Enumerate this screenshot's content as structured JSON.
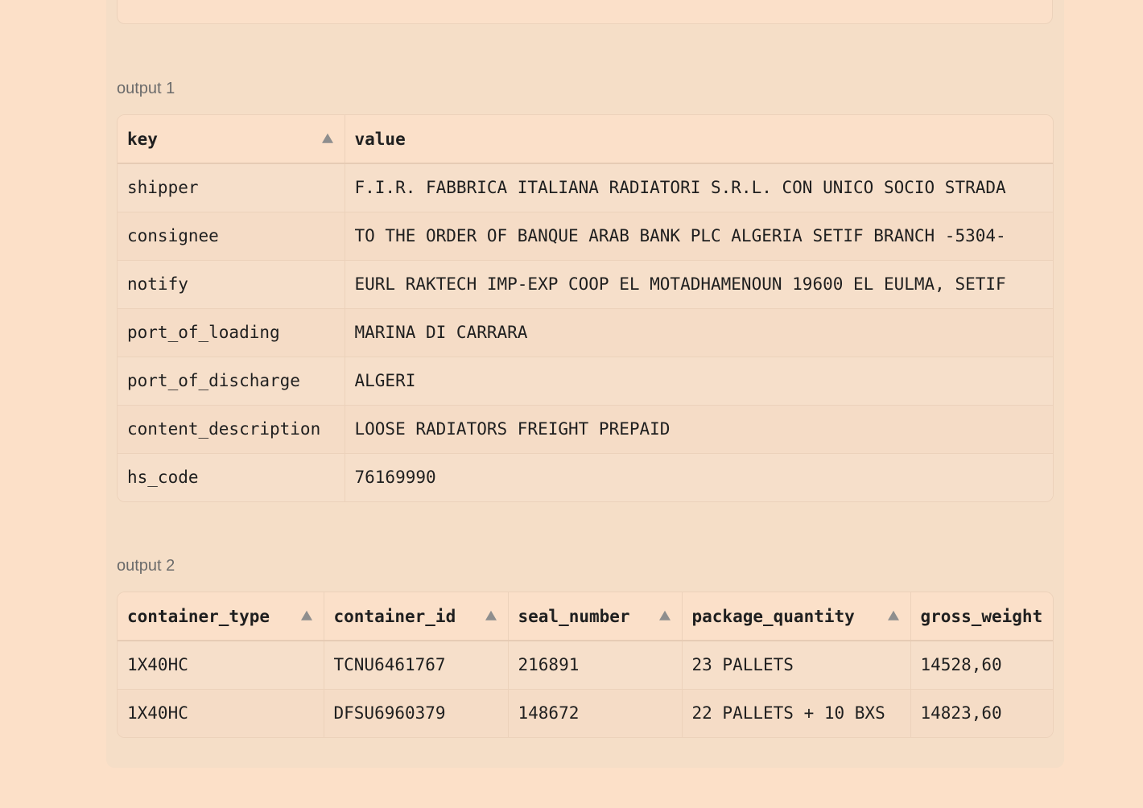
{
  "output1": {
    "label": "output 1",
    "columns": [
      "key",
      "value"
    ],
    "rows": [
      [
        "shipper",
        "F.I.R. FABBRICA ITALIANA RADIATORI S.R.L. CON UNICO SOCIO STRADA"
      ],
      [
        "consignee",
        "TO THE ORDER OF BANQUE ARAB BANK PLC ALGERIA SETIF BRANCH -5304-"
      ],
      [
        "notify",
        "EURL RAKTECH IMP-EXP COOP EL MOTADHAMENOUN 19600 EL EULMA, SETIF"
      ],
      [
        "port_of_loading",
        "MARINA DI CARRARA"
      ],
      [
        "port_of_discharge",
        "ALGERI"
      ],
      [
        "content_description",
        "LOOSE RADIATORS FREIGHT PREPAID"
      ],
      [
        "hs_code",
        "76169990"
      ]
    ]
  },
  "output2": {
    "label": "output 2",
    "columns": [
      "container_type",
      "container_id",
      "seal_number",
      "package_quantity",
      "gross_weight"
    ],
    "rows": [
      [
        "1X40HC",
        "TCNU6461767",
        "216891",
        "23 PALLETS",
        "14528,60"
      ],
      [
        "1X40HC",
        "DFSU6960379",
        "148672",
        "22 PALLETS + 10 BXS",
        "14823,60"
      ]
    ]
  }
}
